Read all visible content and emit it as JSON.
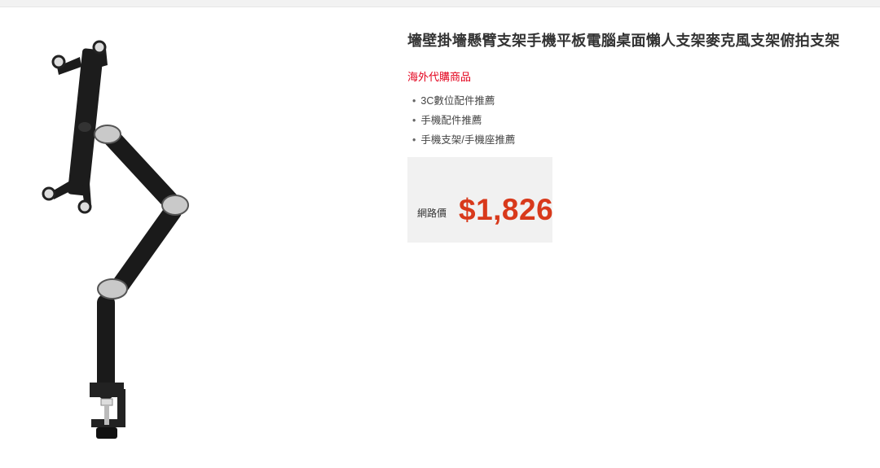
{
  "product": {
    "title": "墻壁掛墻懸臂支架手機平板電腦桌面懶人支架麥克風支架俯拍支架",
    "tag": "海外代購商品",
    "categories": [
      "3C數位配件推薦",
      "手機配件推薦",
      "手機支架/手機座推薦"
    ],
    "price_label": "網路價",
    "price": "$1,826"
  },
  "colors": {
    "accent_red": "#e3001b",
    "price_orange": "#d8391b",
    "price_box_bg": "#f1f1f1"
  },
  "icons": {
    "bullet": "bullet-dot"
  }
}
